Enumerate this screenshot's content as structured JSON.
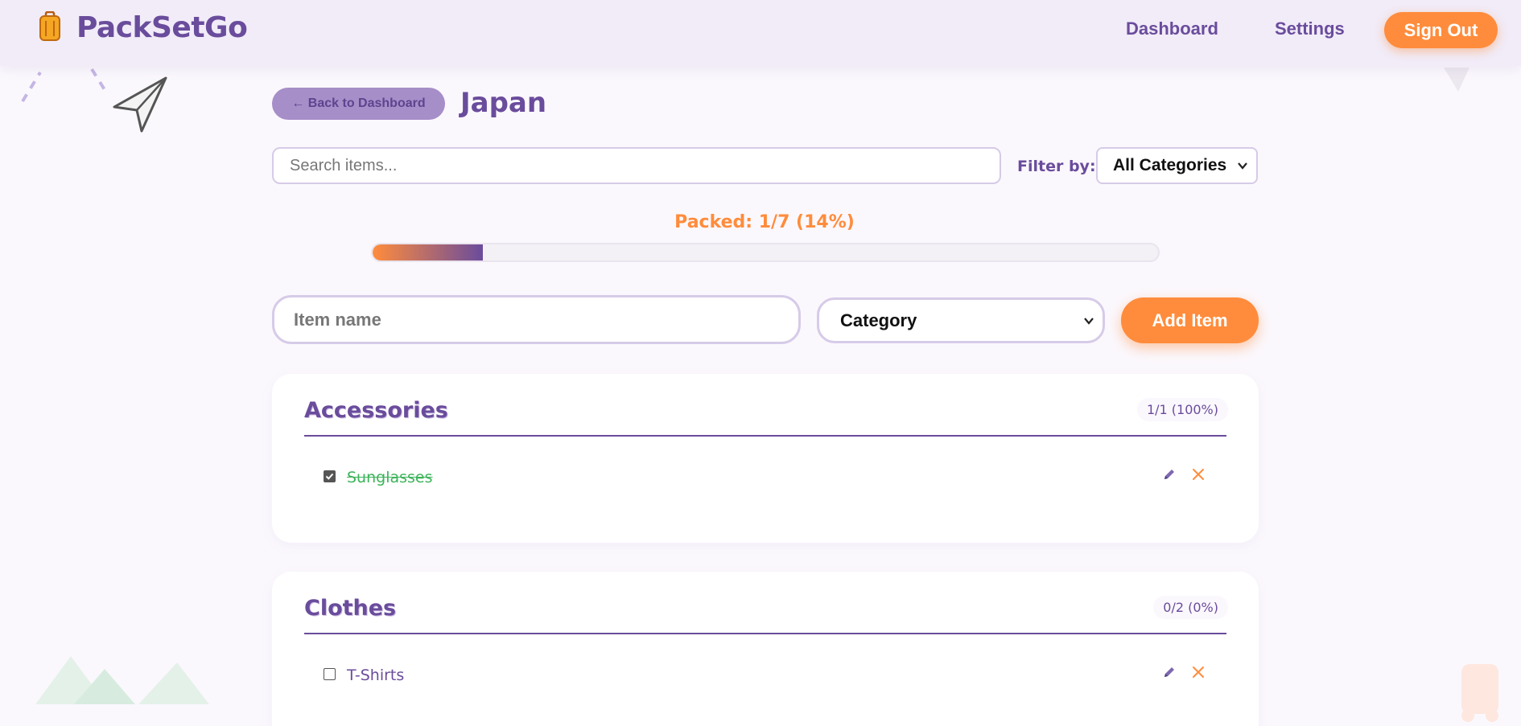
{
  "header": {
    "brand": "PackSetGo",
    "nav": {
      "dashboard": "Dashboard",
      "settings": "Settings",
      "sign_out": "Sign Out"
    }
  },
  "trip": {
    "back_label": "← Back to Dashboard",
    "title": "Japan"
  },
  "search": {
    "placeholder": "Search items...",
    "value": ""
  },
  "filter": {
    "label": "Filter by:",
    "selected": "All Categories"
  },
  "progress": {
    "label": "Packed: 1/7 (14%)",
    "packed": 1,
    "total": 7,
    "percent": 14
  },
  "add_item": {
    "name_placeholder": "Item name",
    "category_selected": "Category",
    "button_label": "Add Item"
  },
  "categories": [
    {
      "name": "Accessories",
      "count_label": "1/1 (100%)",
      "items": [
        {
          "label": "Sunglasses",
          "packed": true
        }
      ]
    },
    {
      "name": "Clothes",
      "count_label": "0/2 (0%)",
      "items": [
        {
          "label": "T-Shirts",
          "packed": false
        }
      ]
    }
  ],
  "colors": {
    "brand_purple": "#6a4c9c",
    "accent_orange": "#ff8c3c",
    "packed_green": "#3cb35a",
    "background": "#fbf8fd"
  },
  "icons": {
    "logo": "suitcase-icon",
    "edit": "pencil-icon",
    "delete": "close-icon",
    "decoration": "paper-plane-icon"
  }
}
